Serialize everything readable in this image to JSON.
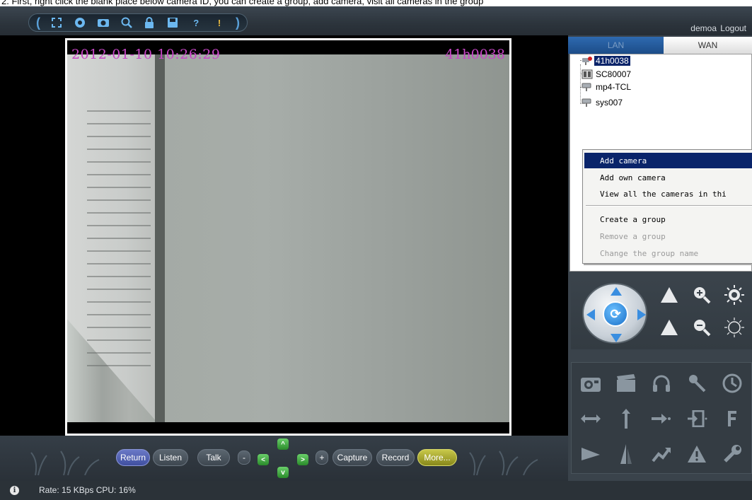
{
  "caption": {
    "text": "2. First, right click the blank place below camera ID, you can create a group, add camera, visit all cameras in the group"
  },
  "toolbar": {
    "tools": [
      "fullscreen-icon",
      "record-icon",
      "camera-icon",
      "search-icon",
      "lock-icon",
      "save-icon",
      "help-icon",
      "info-icon"
    ]
  },
  "header": {
    "user": "demoa",
    "logout": "Logout"
  },
  "video": {
    "timestamp": "2012-01-10 10:26:29",
    "camera_id": "41h0038"
  },
  "controls": {
    "return": "Return",
    "listen": "Listen",
    "talk": "Talk",
    "minus": "-",
    "plus": "+",
    "capture": "Capture",
    "record": "Record",
    "more": "More..."
  },
  "tabs": {
    "lan": "LAN",
    "wan": "WAN"
  },
  "tree": {
    "items": [
      {
        "label": "41h0038",
        "selected": true
      },
      {
        "label": "SC80007",
        "selected": false
      },
      {
        "label": "mp4-TCL",
        "selected": false
      },
      {
        "label": "sys007",
        "selected": false
      }
    ]
  },
  "context_menu": {
    "add_camera": "Add camera",
    "add_own_camera": "Add own camera",
    "view_all": "View all the cameras in thi",
    "create_group": "Create a group",
    "remove_group": "Remove a group",
    "change_group_name": "Change the group name"
  },
  "status": {
    "text": "Rate: 15 KBps  CPU:  16%",
    "info": "i"
  },
  "colors": {
    "accent": "#0a246a",
    "overlay_text": "#c845c6",
    "panel": "#3a434b"
  }
}
